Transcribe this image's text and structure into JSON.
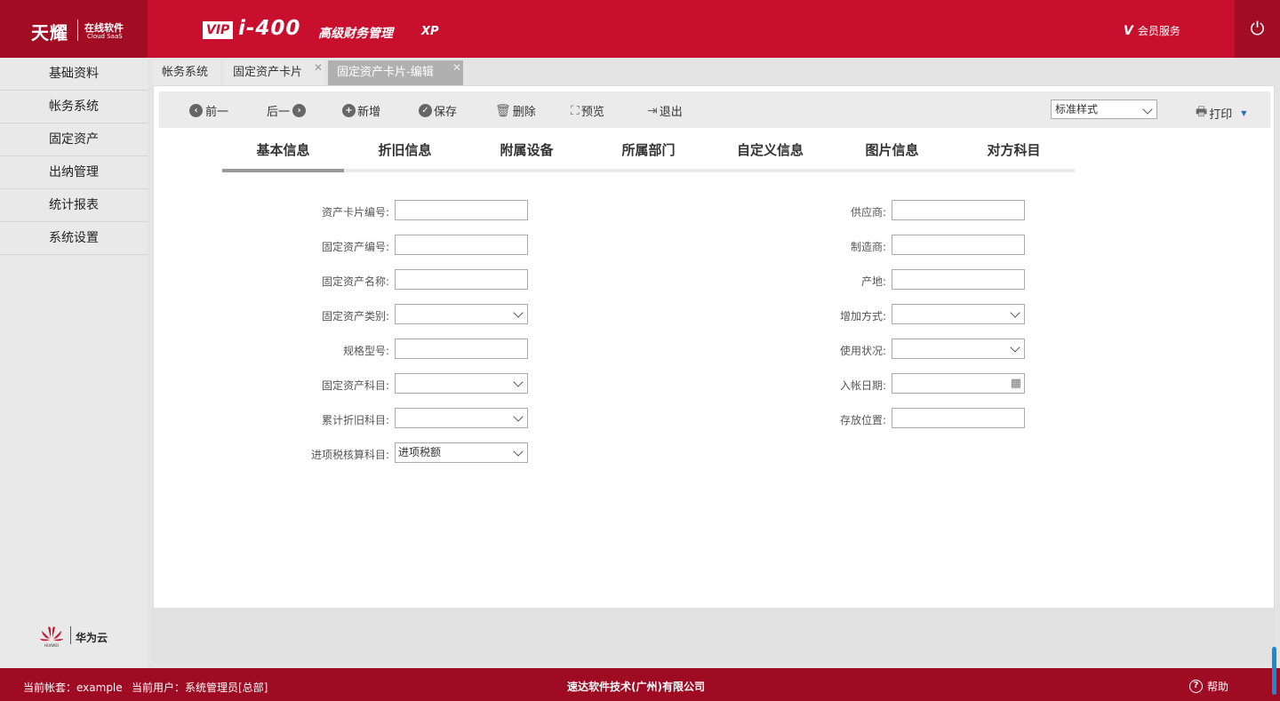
{
  "header": {
    "logo_main": "天耀",
    "logo_sub1": "在线软件",
    "logo_sub2": "Cloud SaaS",
    "vip": "VIP",
    "product": "i-400",
    "product_name": "高级财务管理",
    "edition": "XP",
    "member_v": "V",
    "member_label": "会员服务",
    "power_icon": "power-icon"
  },
  "sidebar": {
    "items": [
      {
        "label": "基础资料"
      },
      {
        "label": "帐务系统"
      },
      {
        "label": "固定资产"
      },
      {
        "label": "出纳管理"
      },
      {
        "label": "统计报表"
      },
      {
        "label": "系统设置"
      }
    ],
    "partner": "华为云",
    "partner_logo_text": "HUAWEI"
  },
  "tabs": [
    {
      "label": "帐务系统",
      "active": false
    },
    {
      "label": "固定资产卡片",
      "active": false
    },
    {
      "label": "固定资产卡片-编辑",
      "active": true
    }
  ],
  "toolbar": {
    "prev": "前一",
    "next": "后一",
    "add": "新增",
    "save": "保存",
    "delete": "删除",
    "preview": "预览",
    "exit": "退出",
    "style_select": "标准样式",
    "print": "打印"
  },
  "subtabs": [
    {
      "label": "基本信息"
    },
    {
      "label": "折旧信息"
    },
    {
      "label": "附属设备"
    },
    {
      "label": "所属部门"
    },
    {
      "label": "自定义信息"
    },
    {
      "label": "图片信息"
    },
    {
      "label": "对方科目"
    }
  ],
  "form": {
    "left": [
      {
        "label": "资产卡片编号:",
        "value": "",
        "type": "text"
      },
      {
        "label": "固定资产编号:",
        "value": "",
        "type": "text"
      },
      {
        "label": "固定资产名称:",
        "value": "",
        "type": "text"
      },
      {
        "label": "固定资产类别:",
        "value": "",
        "type": "select"
      },
      {
        "label": "规格型号:",
        "value": "",
        "type": "text"
      },
      {
        "label": "固定资产科目:",
        "value": "",
        "type": "select"
      },
      {
        "label": "累计折旧科目:",
        "value": "",
        "type": "select"
      },
      {
        "label": "进项税核算科目:",
        "value": "进项税额",
        "type": "select"
      }
    ],
    "right": [
      {
        "label": "供应商:",
        "value": "",
        "type": "text"
      },
      {
        "label": "制造商:",
        "value": "",
        "type": "text"
      },
      {
        "label": "产地:",
        "value": "",
        "type": "text"
      },
      {
        "label": "增加方式:",
        "value": "",
        "type": "select"
      },
      {
        "label": "使用状况:",
        "value": "",
        "type": "select"
      },
      {
        "label": "入帐日期:",
        "value": "",
        "type": "date"
      },
      {
        "label": "存放位置:",
        "value": "",
        "type": "text"
      }
    ]
  },
  "status": {
    "account": "当前帐套：example",
    "user": "当前用户：系统管理员[总部]",
    "company": "速达软件技术(广州)有限公司",
    "help": "帮助"
  },
  "colors": {
    "brand_red": "#c8102e",
    "dark_red": "#a30d24",
    "status_red": "#9e0b22"
  }
}
